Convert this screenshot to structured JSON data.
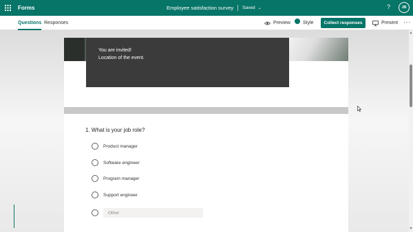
{
  "app": {
    "name": "Forms",
    "form_title": "Employee satisfaction survey",
    "save_status": "Saved",
    "help_label": "?",
    "user_initials": "JB",
    "accent_color": "#077568"
  },
  "tabs": [
    {
      "label": "Questions",
      "active": true
    },
    {
      "label": "Responses",
      "active": false
    }
  ],
  "commands": {
    "preview": "Preview",
    "style": "Style",
    "collect": "Collect responses",
    "present": "Present",
    "more": "···"
  },
  "header_card": {
    "line1": "You are invited!",
    "line2": "Location of the event."
  },
  "question": {
    "number_and_text": "1. What is your job role?",
    "options": [
      "Product manager",
      "Software engineer",
      "Program manager",
      "Support engineer"
    ],
    "other_placeholder": "Other"
  },
  "icons": {
    "app_launcher": "waffle-icon",
    "preview": "eye-icon",
    "style": "palette-icon",
    "present": "monitor-icon"
  }
}
